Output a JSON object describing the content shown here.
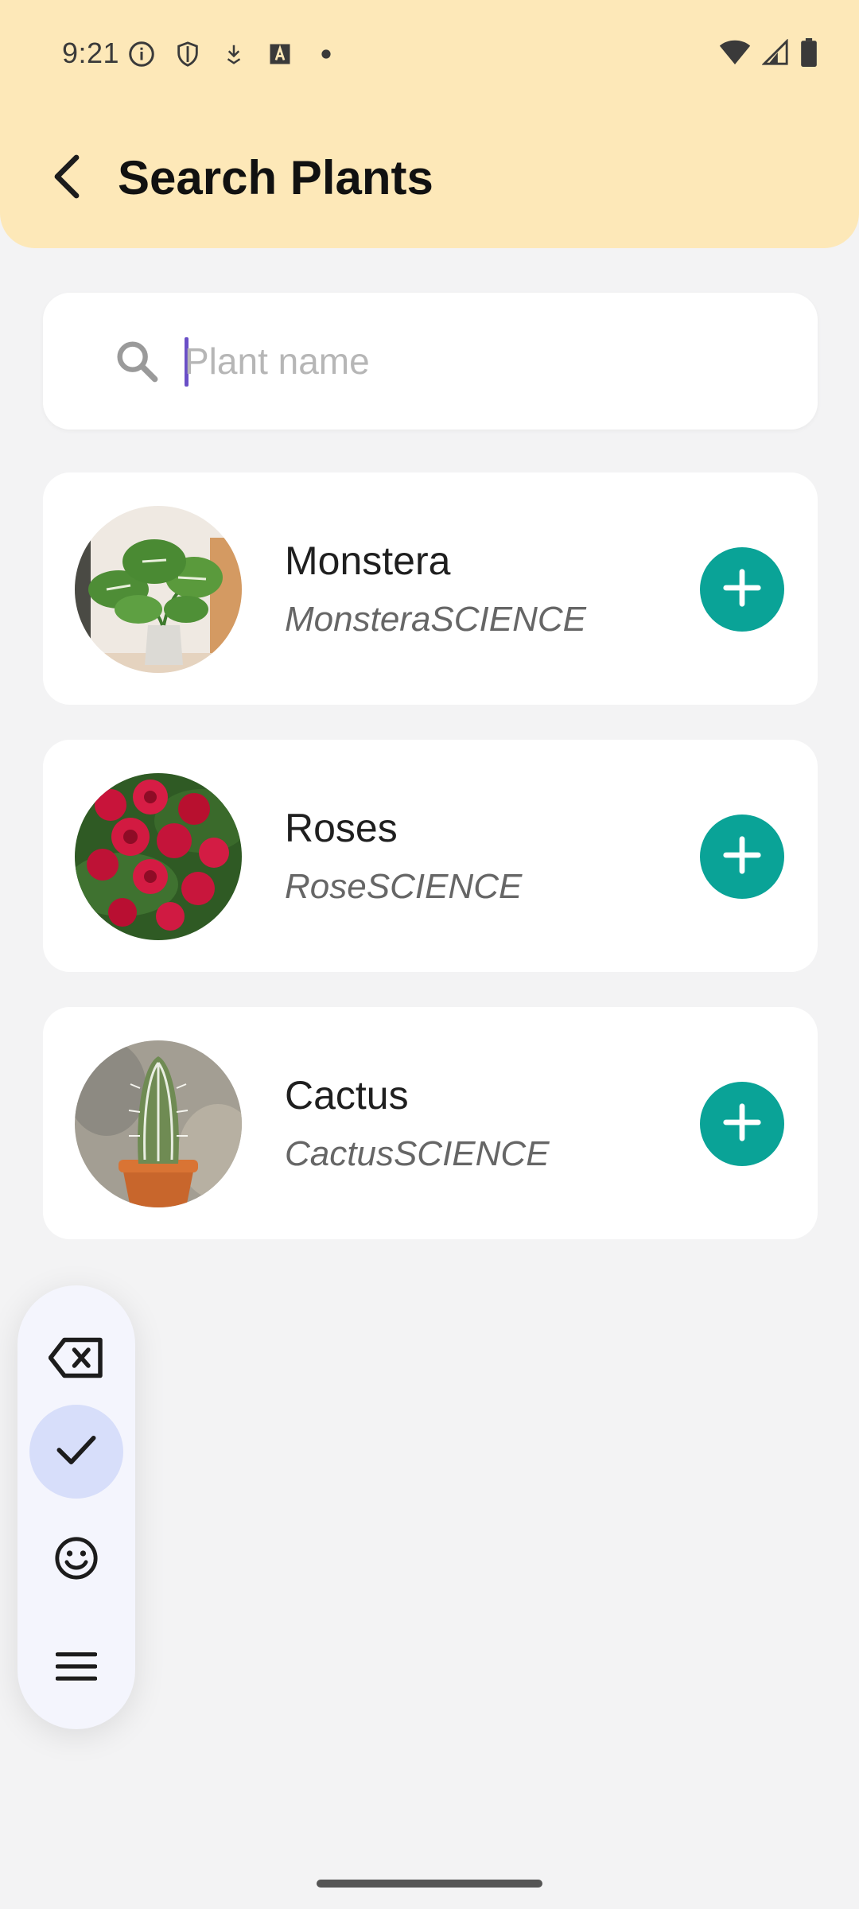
{
  "status_bar": {
    "time": "9:21",
    "left_icons": [
      "info-icon",
      "shield-icon",
      "download-icon",
      "font-icon",
      "dot-icon"
    ],
    "right_icons": [
      "wifi-icon",
      "signal-icon",
      "battery-icon"
    ]
  },
  "header": {
    "title": "Search Plants",
    "back_icon": "arrow-back-icon"
  },
  "search": {
    "placeholder": "Plant name",
    "value": ""
  },
  "plants": [
    {
      "name": "Monstera",
      "scientific": "MonsteraSCIENCE",
      "image": "monstera-plant-photo"
    },
    {
      "name": "Roses",
      "scientific": "RoseSCIENCE",
      "image": "roses-photo"
    },
    {
      "name": "Cactus",
      "scientific": "CactusSCIENCE",
      "image": "cactus-photo"
    }
  ],
  "keyboard_toolbar": {
    "items": [
      "backspace-icon",
      "check-icon",
      "emoji-icon",
      "menu-icon"
    ],
    "active_item": "check-icon"
  },
  "colors": {
    "appbar": "#fde8b8",
    "accent": "#0aa397",
    "background": "#f3f3f4",
    "cursor": "#6a4fc7"
  }
}
